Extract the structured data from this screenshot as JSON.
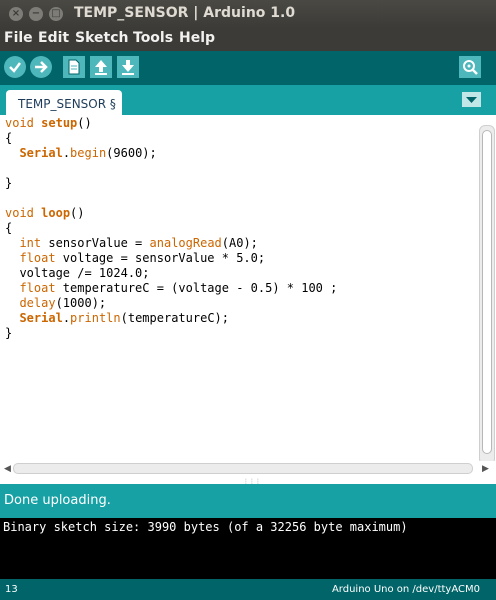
{
  "window": {
    "title": "TEMP_SENSOR | Arduino 1.0"
  },
  "menu": {
    "items": [
      "File",
      "Edit",
      "Sketch",
      "Tools",
      "Help"
    ]
  },
  "toolbar": {
    "buttons": [
      "verify-icon",
      "upload-icon",
      "new-icon",
      "open-icon",
      "save-icon",
      "serial-monitor-icon"
    ],
    "accent": "#4db7bb",
    "background": "#006468"
  },
  "tabs": [
    {
      "label": "TEMP_SENSOR §"
    }
  ],
  "editor": {
    "lines": [
      "void setup()",
      "{",
      "  Serial.begin(9600);",
      "",
      "}",
      "",
      "void loop()",
      "{",
      "  int sensorValue = analogRead(A0);",
      "  float voltage = sensorValue * 5.0;",
      "  voltage /= 1024.0;",
      "  float temperatureC = (voltage - 0.5) * 100 ;",
      "  delay(1000);",
      "  Serial.println(temperatureC);",
      "}"
    ]
  },
  "status": {
    "message": "Done uploading."
  },
  "console": {
    "text": "Binary sketch size: 3990 bytes (of a 32256 byte maximum)"
  },
  "footer": {
    "line": "13",
    "board": "Arduino Uno on /dev/ttyACM0"
  }
}
